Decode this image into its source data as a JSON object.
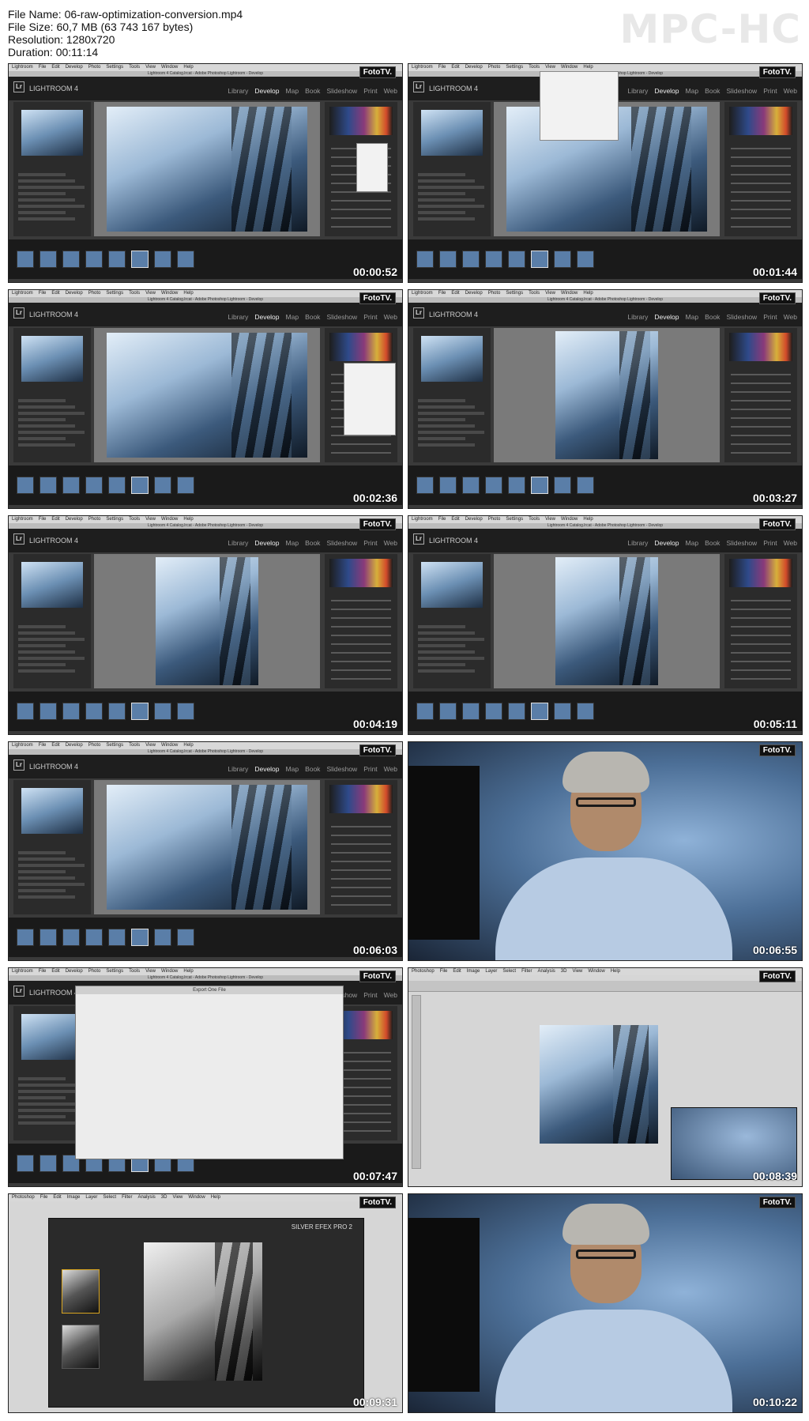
{
  "file_info": {
    "file_name": "File Name: 06-raw-optimization-conversion.mp4",
    "file_size": "File Size: 60,7 MB (63 743 167 bytes)",
    "resolution": "Resolution: 1280x720",
    "duration": "Duration: 00:11:14"
  },
  "brand": "MPC-HC",
  "watermark": "FotoTV.",
  "app": {
    "logo": "Lr",
    "name": "LIGHTROOM 4",
    "window_title": "Lightroom 4 Catalog.lrcat - Adobe Photoshop Lightroom - Develop",
    "menu": [
      "Lightroom",
      "File",
      "Edit",
      "Develop",
      "Photo",
      "Settings",
      "Tools",
      "View",
      "Window",
      "Help"
    ],
    "modules": [
      "Library",
      "Develop",
      "Map",
      "Book",
      "Slideshow",
      "Print",
      "Web"
    ]
  },
  "ps_app": {
    "menu": [
      "Photoshop",
      "File",
      "Edit",
      "Image",
      "Layer",
      "Select",
      "Filter",
      "Analysis",
      "3D",
      "View",
      "Window",
      "Help"
    ]
  },
  "dialog": {
    "title": "Export One File"
  },
  "silver_efex": {
    "title": "SILVER EFEX PRO 2"
  },
  "frames": [
    {
      "time": "00:00:52",
      "type": "lightroom"
    },
    {
      "time": "00:01:44",
      "type": "lightroom"
    },
    {
      "time": "00:02:36",
      "type": "lightroom"
    },
    {
      "time": "00:03:27",
      "type": "lightroom"
    },
    {
      "time": "00:04:19",
      "type": "lightroom"
    },
    {
      "time": "00:05:11",
      "type": "lightroom"
    },
    {
      "time": "00:06:03",
      "type": "lightroom"
    },
    {
      "time": "00:06:55",
      "type": "person"
    },
    {
      "time": "00:07:47",
      "type": "export"
    },
    {
      "time": "00:08:39",
      "type": "photoshop"
    },
    {
      "time": "00:09:31",
      "type": "silverefex"
    },
    {
      "time": "00:10:22",
      "type": "person"
    }
  ]
}
